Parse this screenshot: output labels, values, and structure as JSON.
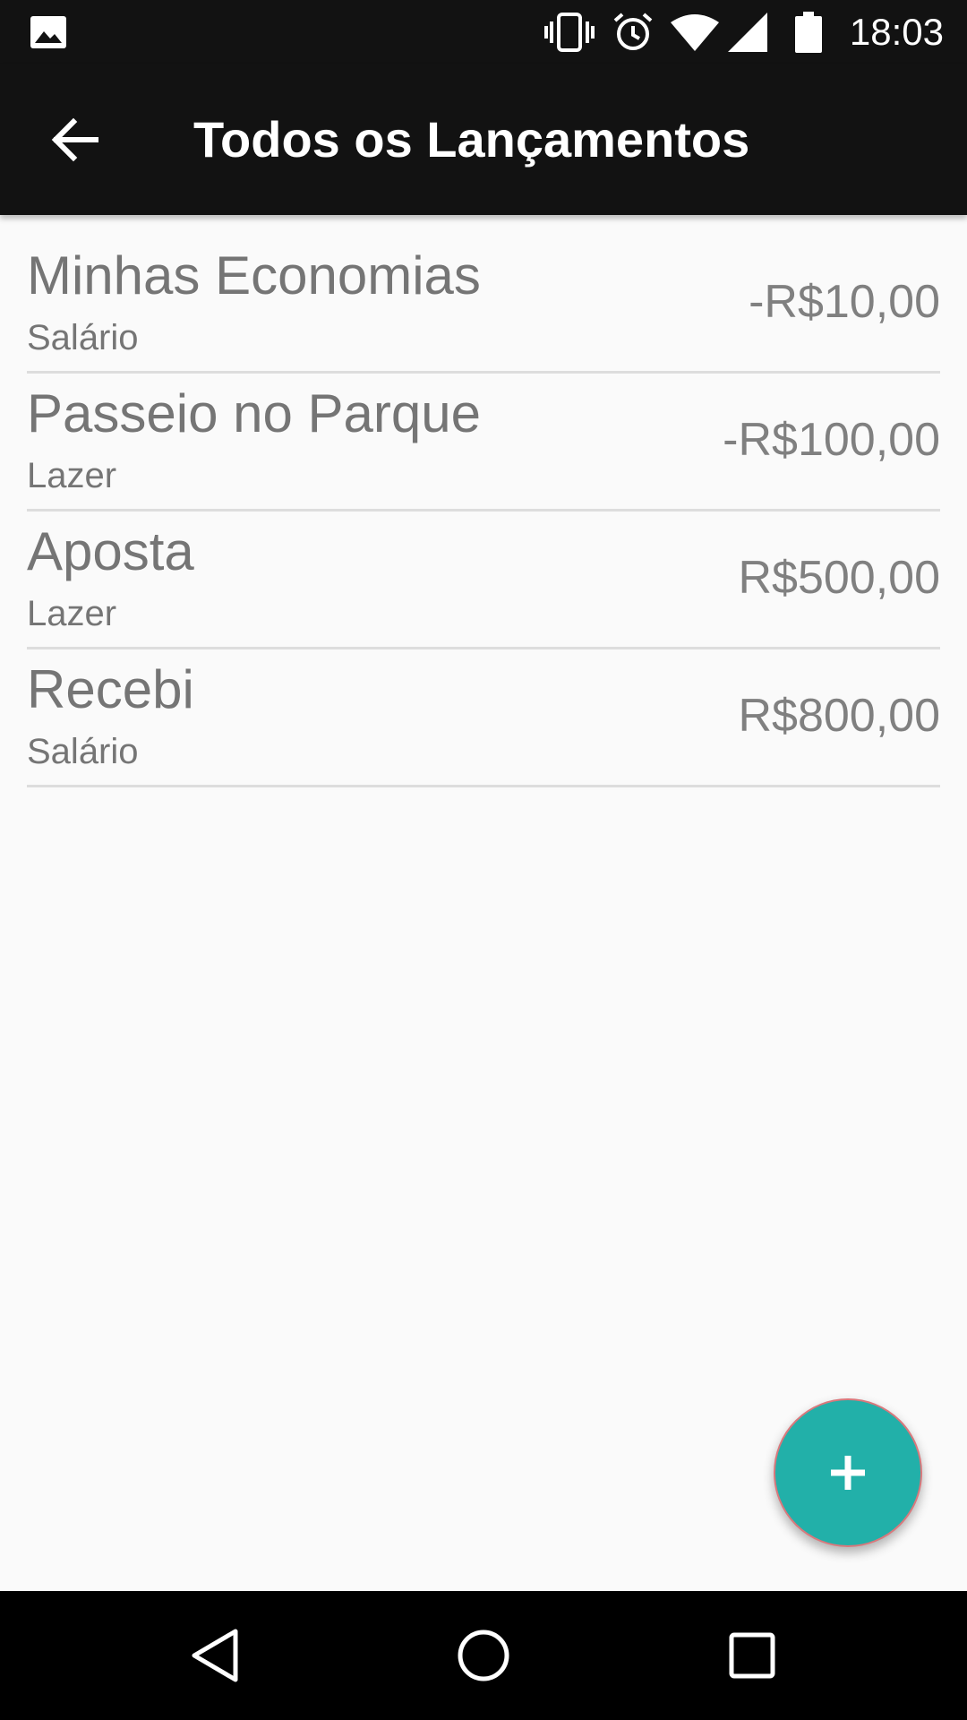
{
  "status_bar": {
    "time": "18:03",
    "icons": [
      "image-icon",
      "vibrate-icon",
      "alarm-icon",
      "wifi-icon",
      "signal-icon",
      "battery-icon"
    ]
  },
  "app_bar": {
    "title": "Todos os Lançamentos",
    "back_icon": "arrow-left-icon"
  },
  "entries": [
    {
      "title": "Minhas Economias",
      "category": "Salário",
      "amount": "-R$10,00"
    },
    {
      "title": "Passeio no Parque",
      "category": "Lazer",
      "amount": "-R$100,00"
    },
    {
      "title": "Aposta",
      "category": "Lazer",
      "amount": "R$500,00"
    },
    {
      "title": "Recebi",
      "category": "Salário",
      "amount": "R$800,00"
    }
  ],
  "fab": {
    "icon": "plus-icon"
  },
  "nav_bar": {
    "icons": [
      "back-triangle-icon",
      "home-circle-icon",
      "recents-square-icon"
    ]
  },
  "colors": {
    "bars": "#121212",
    "background": "#fafafa",
    "text": "#757575",
    "divider": "#dddddd",
    "fab": "#22b0a9"
  }
}
